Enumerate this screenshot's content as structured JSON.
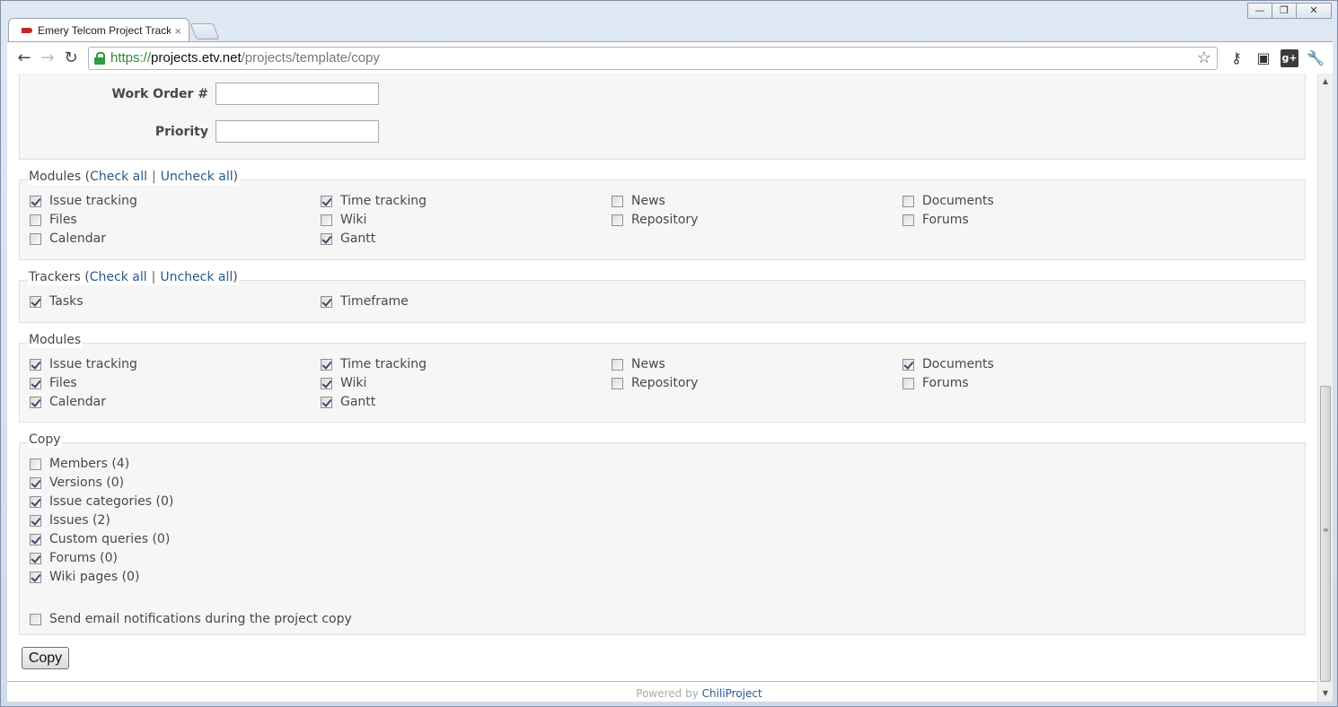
{
  "browser": {
    "tab_title": "Emery Telcom Project Track",
    "url_scheme": "https://",
    "url_host": "projects.etv.net",
    "url_path": "/projects/template/copy"
  },
  "form": {
    "work_order_label": "Work Order #",
    "work_order_value": "",
    "priority_label": "Priority",
    "priority_value": ""
  },
  "modules_select": {
    "legend": "Modules",
    "check_all": "Check all",
    "uncheck_all": "Uncheck all",
    "items": [
      {
        "label": "Issue tracking",
        "checked": true
      },
      {
        "label": "Time tracking",
        "checked": true
      },
      {
        "label": "News",
        "checked": false
      },
      {
        "label": "Documents",
        "checked": false
      },
      {
        "label": "Files",
        "checked": false
      },
      {
        "label": "Wiki",
        "checked": false
      },
      {
        "label": "Repository",
        "checked": false
      },
      {
        "label": "Forums",
        "checked": false
      },
      {
        "label": "Calendar",
        "checked": false
      },
      {
        "label": "Gantt",
        "checked": true
      }
    ]
  },
  "trackers": {
    "legend": "Trackers",
    "check_all": "Check all",
    "uncheck_all": "Uncheck all",
    "items": [
      {
        "label": "Tasks",
        "checked": true
      },
      {
        "label": "Timeframe",
        "checked": true
      }
    ]
  },
  "modules": {
    "legend": "Modules",
    "items": [
      {
        "label": "Issue tracking",
        "checked": true
      },
      {
        "label": "Time tracking",
        "checked": true
      },
      {
        "label": "News",
        "checked": false
      },
      {
        "label": "Documents",
        "checked": true
      },
      {
        "label": "Files",
        "checked": true
      },
      {
        "label": "Wiki",
        "checked": true
      },
      {
        "label": "Repository",
        "checked": false
      },
      {
        "label": "Forums",
        "checked": false
      },
      {
        "label": "Calendar",
        "checked": true
      },
      {
        "label": "Gantt",
        "checked": true
      }
    ]
  },
  "copy": {
    "legend": "Copy",
    "items": [
      {
        "label": "Members (4)",
        "checked": false
      },
      {
        "label": "Versions (0)",
        "checked": true
      },
      {
        "label": "Issue categories (0)",
        "checked": true
      },
      {
        "label": "Issues (2)",
        "checked": true
      },
      {
        "label": "Custom queries (0)",
        "checked": true
      },
      {
        "label": "Forums (0)",
        "checked": true
      },
      {
        "label": "Wiki pages (0)",
        "checked": true
      }
    ],
    "notify": {
      "label": "Send email notifications during the project copy",
      "checked": false
    },
    "submit_label": "Copy"
  },
  "footer": {
    "powered_by": "Powered by",
    "link": "ChiliProject"
  }
}
